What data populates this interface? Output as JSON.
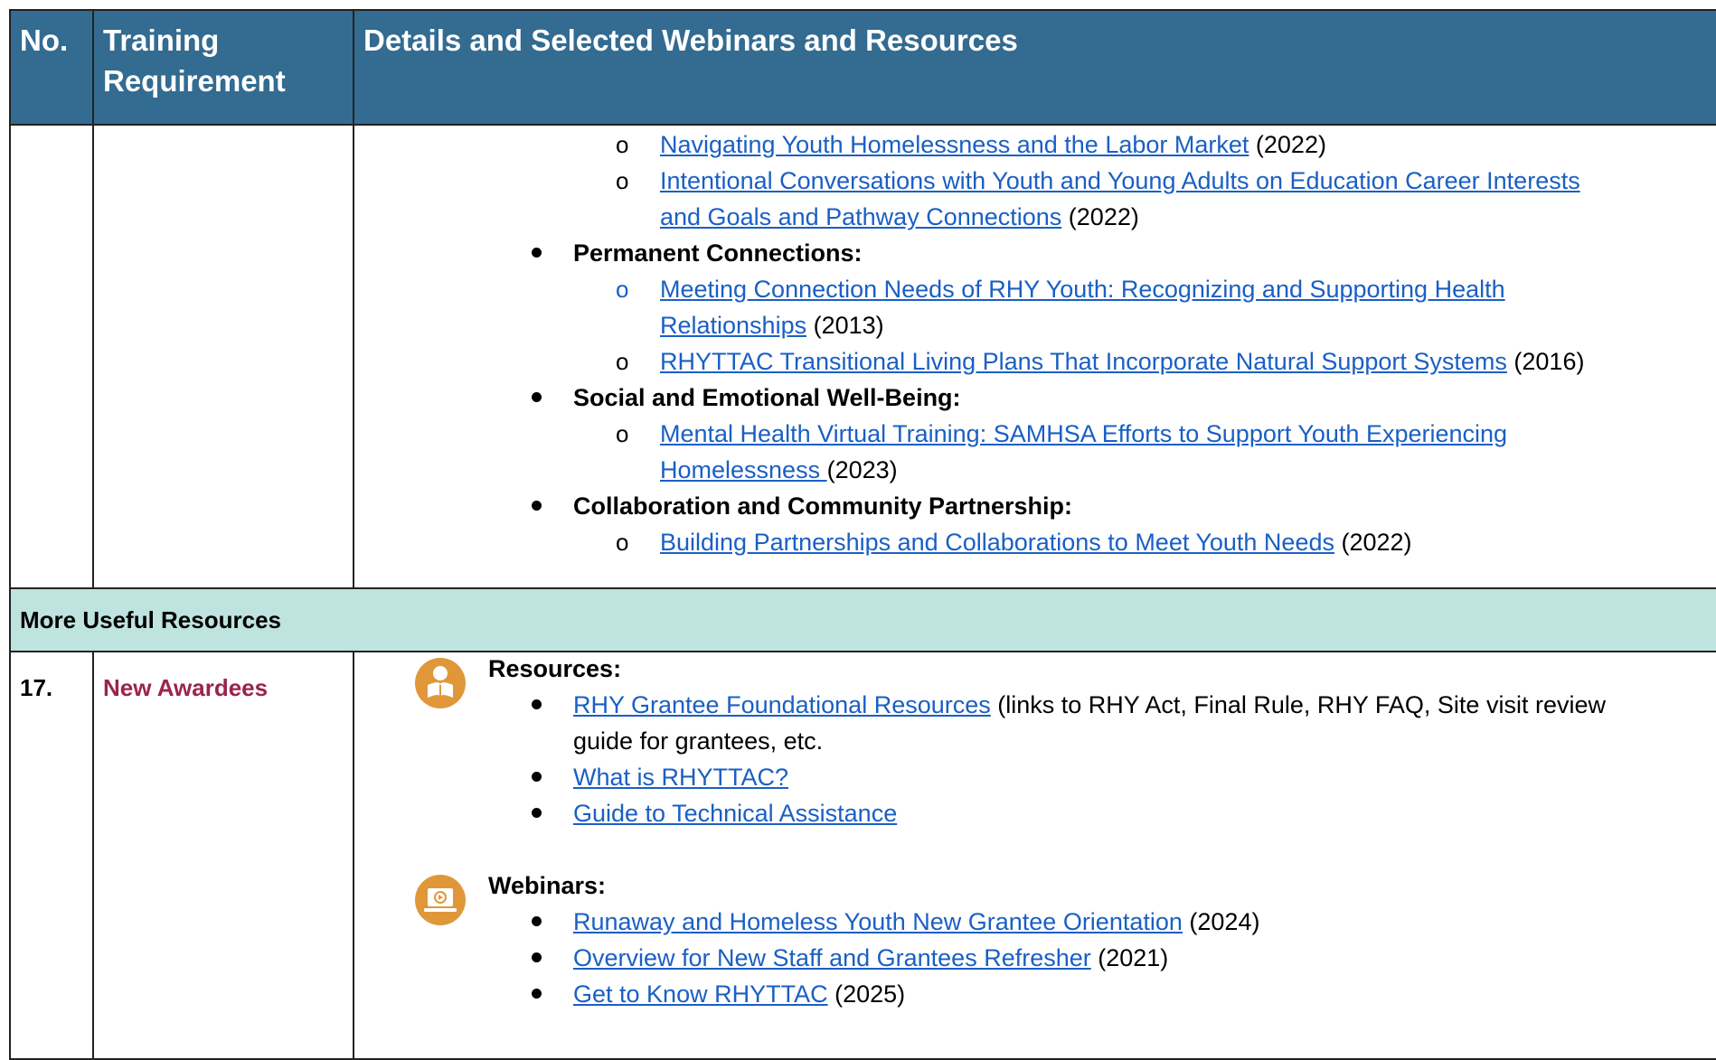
{
  "header": {
    "no": "No.",
    "training": "Training Requirement",
    "details": "Details and Selected Webinars and Resources"
  },
  "row1": {
    "items": [
      {
        "link": "Navigating Youth Homelessness and the Labor Market",
        "suffix": " (2022)"
      },
      {
        "link_a": "Intentional Conversations with Youth and Young Adults on Education Career Interests",
        "link_b": "and Goals and Pathway Connections",
        "suffix": " (2022)"
      }
    ],
    "permanent": {
      "heading": "Permanent Connections:",
      "items": [
        {
          "link_a": "Meeting Connection Needs of RHY Youth: Recognizing and Supporting Health",
          "link_b": "Relationships",
          "suffix": " (2013)"
        },
        {
          "link": "RHYTTAC Transitional Living Plans That Incorporate Natural Support Systems",
          "suffix": " (2016)"
        }
      ]
    },
    "social": {
      "heading": "Social and Emotional Well-Being:",
      "items": [
        {
          "link_a": "Mental Health Virtual Training: SAMHSA Efforts to Support Youth Experiencing",
          "link_b": "Homelessness ",
          "suffix": "(2023)"
        }
      ]
    },
    "collab": {
      "heading": "Collaboration and Community Partnership:",
      "items": [
        {
          "link": "Building Partnerships and Collaborations to Meet Youth Needs",
          "suffix": " (2022)"
        }
      ]
    }
  },
  "section": {
    "title": "More Useful Resources"
  },
  "row17": {
    "number": "17.",
    "requirement": "New Awardees",
    "resources": {
      "heading": "Resources:",
      "icon": "reader-icon",
      "items": [
        {
          "link": "RHY Grantee Foundational Resources",
          "suffix": " (links to RHY Act, Final Rule, RHY FAQ, Site visit review",
          "cont": "guide for grantees, etc."
        },
        {
          "link": "What is RHYTTAC?"
        },
        {
          "link": "Guide to Technical Assistance"
        }
      ]
    },
    "webinars": {
      "heading": "Webinars:",
      "icon": "video-laptop-icon",
      "items": [
        {
          "link": "Runaway and Homeless Youth New Grantee Orientation",
          "suffix": " (2024)"
        },
        {
          "link": "Overview for New Staff and Grantees Refresher",
          "suffix": " (2021)"
        },
        {
          "link": "Get to Know RHYTTAC",
          "suffix": " (2025)"
        }
      ]
    }
  },
  "colors": {
    "header_bg": "#336b91",
    "section_bg": "#bfe3de",
    "link": "#1a5fc4",
    "awardee": "#9b2350",
    "icon": "#e0973a"
  }
}
